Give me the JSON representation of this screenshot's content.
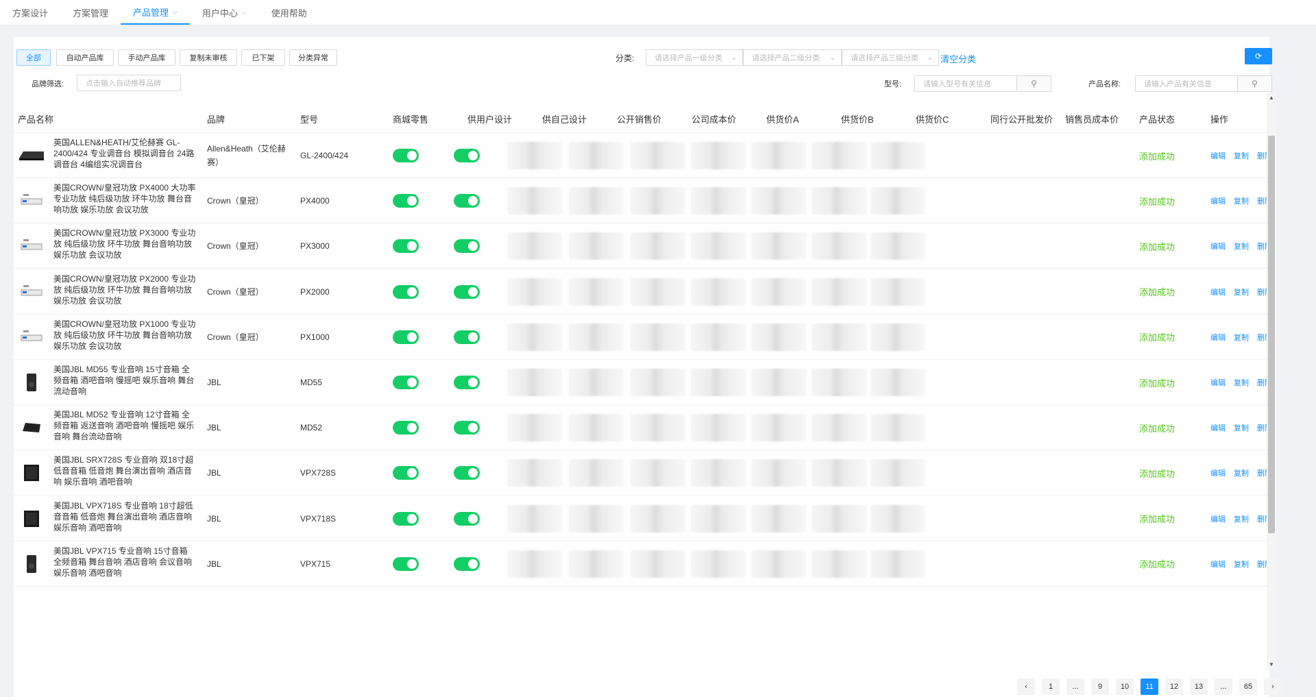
{
  "topnav": {
    "tabs": [
      {
        "label": "方案设计"
      },
      {
        "label": "方案管理"
      },
      {
        "label": "产品管理",
        "dropdown": true
      },
      {
        "label": "用户中心",
        "dropdown": true
      },
      {
        "label": "使用帮助"
      }
    ],
    "active_tab": "产品管理"
  },
  "filters": {
    "buttons": [
      "全部",
      "自动产品库",
      "手动产品库",
      "复制未审核",
      "已下架",
      "分类异常"
    ],
    "active_button": "全部",
    "category_label": "分类:",
    "category_selects": [
      "请选择产品一级分类",
      "请选择产品二级分类",
      "请选择产品三级分类"
    ],
    "clear_category": "清空分类",
    "brand_label": "品牌筛选:",
    "brand_placeholder": "点击输入自动推荐品牌",
    "model_label": "型号:",
    "model_placeholder": "请输入型号有关信息",
    "name_label": "产品名称:",
    "name_placeholder": "请输入产品有关信息"
  },
  "table": {
    "columns": [
      "产品名称",
      "品牌",
      "型号",
      "商城零售",
      "供用户设计",
      "供自己设计",
      "公开销售价",
      "公司成本价",
      "供货价A",
      "供货价B",
      "供货价C",
      "同行公开批发价",
      "销售员成本价",
      "产品状态",
      "操作"
    ],
    "ops": {
      "edit": "编辑",
      "copy": "复制",
      "delete": "删除"
    },
    "rows": [
      {
        "name": "英国ALLEN&HEATH/艾伦赫赛 GL-2400/424 专业调音台 模拟调音台 24路调音台 4编组实况调音台",
        "brand": "Allen&Heath（艾伦赫赛）",
        "model": "GL-2400/424",
        "status": "添加成功",
        "thumb": "mixer-icon"
      },
      {
        "name": "美国CROWN/皇冠功放 PX4000 大功率专业功放 纯后级功放 环牛功放 舞台音响功放 娱乐功放 会议功放",
        "brand": "Crown（皇冠）",
        "model": "PX4000",
        "status": "添加成功",
        "thumb": "amplifier-icon"
      },
      {
        "name": "美国CROWN/皇冠功放 PX3000 专业功放 纯后级功放 环牛功放 舞台音响功放 娱乐功放 会议功放",
        "brand": "Crown（皇冠）",
        "model": "PX3000",
        "status": "添加成功",
        "thumb": "amplifier-icon"
      },
      {
        "name": "美国CROWN/皇冠功放 PX2000 专业功放 纯后级功放 环牛功放 舞台音响功放 娱乐功放 会议功放",
        "brand": "Crown（皇冠）",
        "model": "PX2000",
        "status": "添加成功",
        "thumb": "amplifier-icon"
      },
      {
        "name": "美国CROWN/皇冠功放 PX1000 专业功放 纯后级功放 环牛功放 舞台音响功放 娱乐功放 会议功放",
        "brand": "Crown（皇冠）",
        "model": "PX1000",
        "status": "添加成功",
        "thumb": "amplifier-icon"
      },
      {
        "name": "美国JBL MD55 专业音响 15寸音箱 全频音箱 酒吧音响 慢摇吧 娱乐音响 舞台流动音响",
        "brand": "JBL",
        "model": "MD55",
        "status": "添加成功",
        "thumb": "speaker-icon"
      },
      {
        "name": "美国JBL MD52 专业音响 12寸音箱 全频音箱 返送音响 酒吧音响 慢摇吧 娱乐音响 舞台流动音响",
        "brand": "JBL",
        "model": "MD52",
        "status": "添加成功",
        "thumb": "monitor-speaker-icon"
      },
      {
        "name": "美国JBL SRX728S 专业音响 双18寸超低音音箱 低音炮 舞台演出音响 酒店音响 娱乐音响 酒吧音响",
        "brand": "JBL",
        "model": "VPX728S",
        "status": "添加成功",
        "thumb": "subwoofer-icon"
      },
      {
        "name": "美国JBL VPX718S 专业音响 18寸超低音音箱 低音炮 舞台演出音响 酒店音响 娱乐音响 酒吧音响",
        "brand": "JBL",
        "model": "VPX718S",
        "status": "添加成功",
        "thumb": "subwoofer-icon"
      },
      {
        "name": "美国JBL VPX715 专业音响 15寸音箱 全频音箱 舞台音响 酒店音响 会议音响 娱乐音响 酒吧音响",
        "brand": "JBL",
        "model": "VPX715",
        "status": "添加成功",
        "thumb": "speaker-icon"
      }
    ]
  },
  "pagination": {
    "prev": "‹",
    "next": "›",
    "pages": [
      "1",
      "...",
      "9",
      "10",
      "11",
      "12",
      "13",
      "...",
      "65"
    ],
    "current": "11"
  },
  "colors": {
    "accent": "#1890ff",
    "toggle_on": "#13ce66",
    "status_ok": "#52c41a"
  }
}
